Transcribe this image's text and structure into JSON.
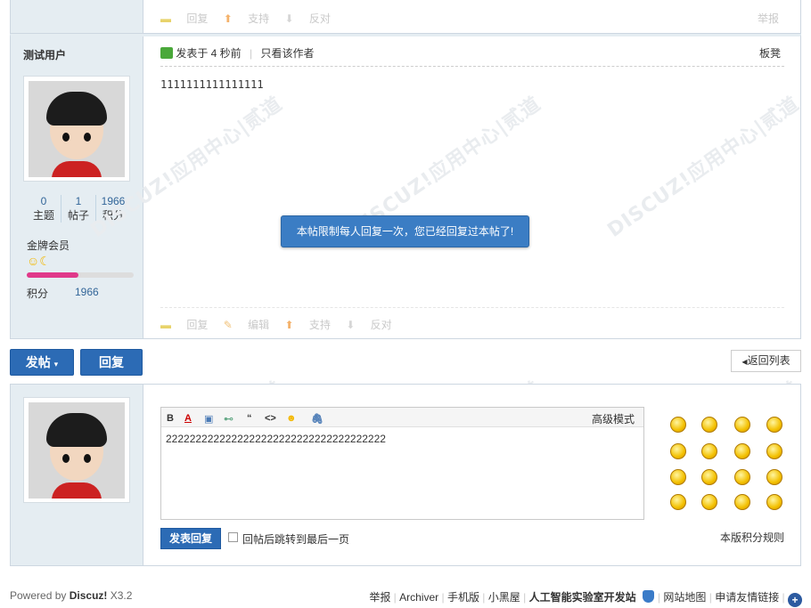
{
  "top_actions": {
    "reply": "回复",
    "support": "支持",
    "oppose": "反对",
    "report": "举报"
  },
  "post": {
    "author": "测试用户",
    "posted_meta": "发表于 4 秒前",
    "only_author": "只看该作者",
    "floor": "板凳",
    "content": "1111111111111111",
    "stats": [
      {
        "value": "0",
        "label": "主题"
      },
      {
        "value": "1",
        "label": "帖子"
      },
      {
        "value": "1966",
        "label": "积分"
      }
    ],
    "level": "金牌会员",
    "credit_label": "积分",
    "credit_value": "1966",
    "actions": {
      "reply": "回复",
      "edit": "编辑",
      "support": "支持",
      "oppose": "反对"
    }
  },
  "toast": "本帖限制每人回复一次，您已经回复过本帖了!",
  "toolbar": {
    "new_post": "发帖",
    "reply": "回复",
    "back_to_list": "返回列表"
  },
  "editor": {
    "advanced_mode": "高级模式",
    "text": "2222222222222222222222222222222222222",
    "submit": "发表回复",
    "jump_label": "回帖后跳转到最后一页",
    "rules": "本版积分规则"
  },
  "footer": {
    "powered_prefix": "Powered by",
    "brand": "Discuz!",
    "version": "X3.2",
    "links": [
      "举报",
      "Archiver",
      "手机版",
      "小黑屋"
    ],
    "site": "人工智能实验室开发站",
    "links2": [
      "网站地图",
      "申请友情链接"
    ]
  },
  "colors": {
    "accent": "#2c6bb5",
    "side_bg": "#e5edf2",
    "toast": "#3b7dc4",
    "progress": "#e0398a"
  }
}
